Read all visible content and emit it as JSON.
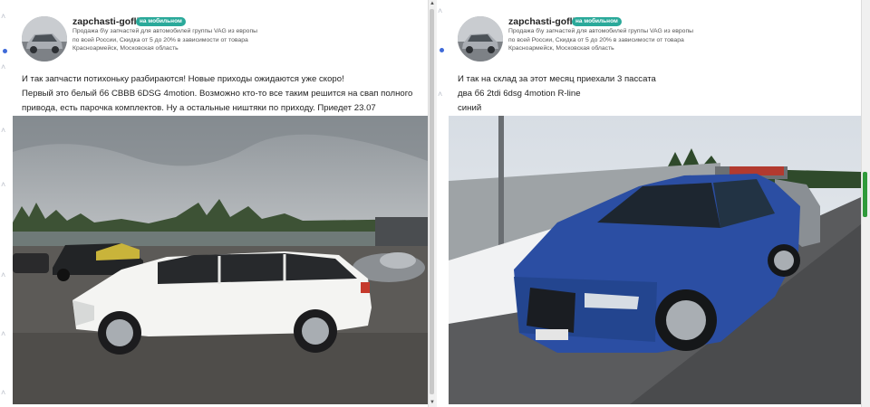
{
  "posts": [
    {
      "author": "zapchasti-goflik",
      "badge": "на мобильном",
      "description": [
        "Продажа б\\у запчастей для автомобилей группы VAG из европы",
        "по всей России, Скидка от 5 до 20% в зависимости от товара",
        "Красноармейск, Московская область"
      ],
      "text": [
        "И так запчасти потихоньку разбираются! Новые приходы ожидаются уже скоро!",
        "Первый это белый б6 CBBB 6DSG 4motion. Возможно кто-то все таким решится на свап полного",
        "привода, есть парочка комплектов. Ну а остальные ништяки по приходу. Приедет 23.07"
      ]
    },
    {
      "author": "zapchasti-goflik",
      "badge": "на мобильном",
      "description": [
        "Продажа б\\у запчастей для автомобилей группы VAG из европы",
        "по всей России, Скидка от 5 до 20% в зависимости от товара",
        "Красноармейск, Московская область"
      ],
      "text": [
        "И так на склад за этот месяц приехали 3 пассата",
        "два б6 2tdi 6dsg 4motion R-line",
        "синий"
      ]
    }
  ],
  "icons": [
    "chevron-up-icon",
    "chevron-down-icon",
    "active-dot-icon",
    "scroll-up-arrow-icon",
    "scroll-down-arrow-icon"
  ],
  "colors": {
    "badge": "#2aa99a",
    "active_dot": "#3f6ad8",
    "white_car": "#f4f4f2",
    "blue_car": "#2b4ea3"
  }
}
